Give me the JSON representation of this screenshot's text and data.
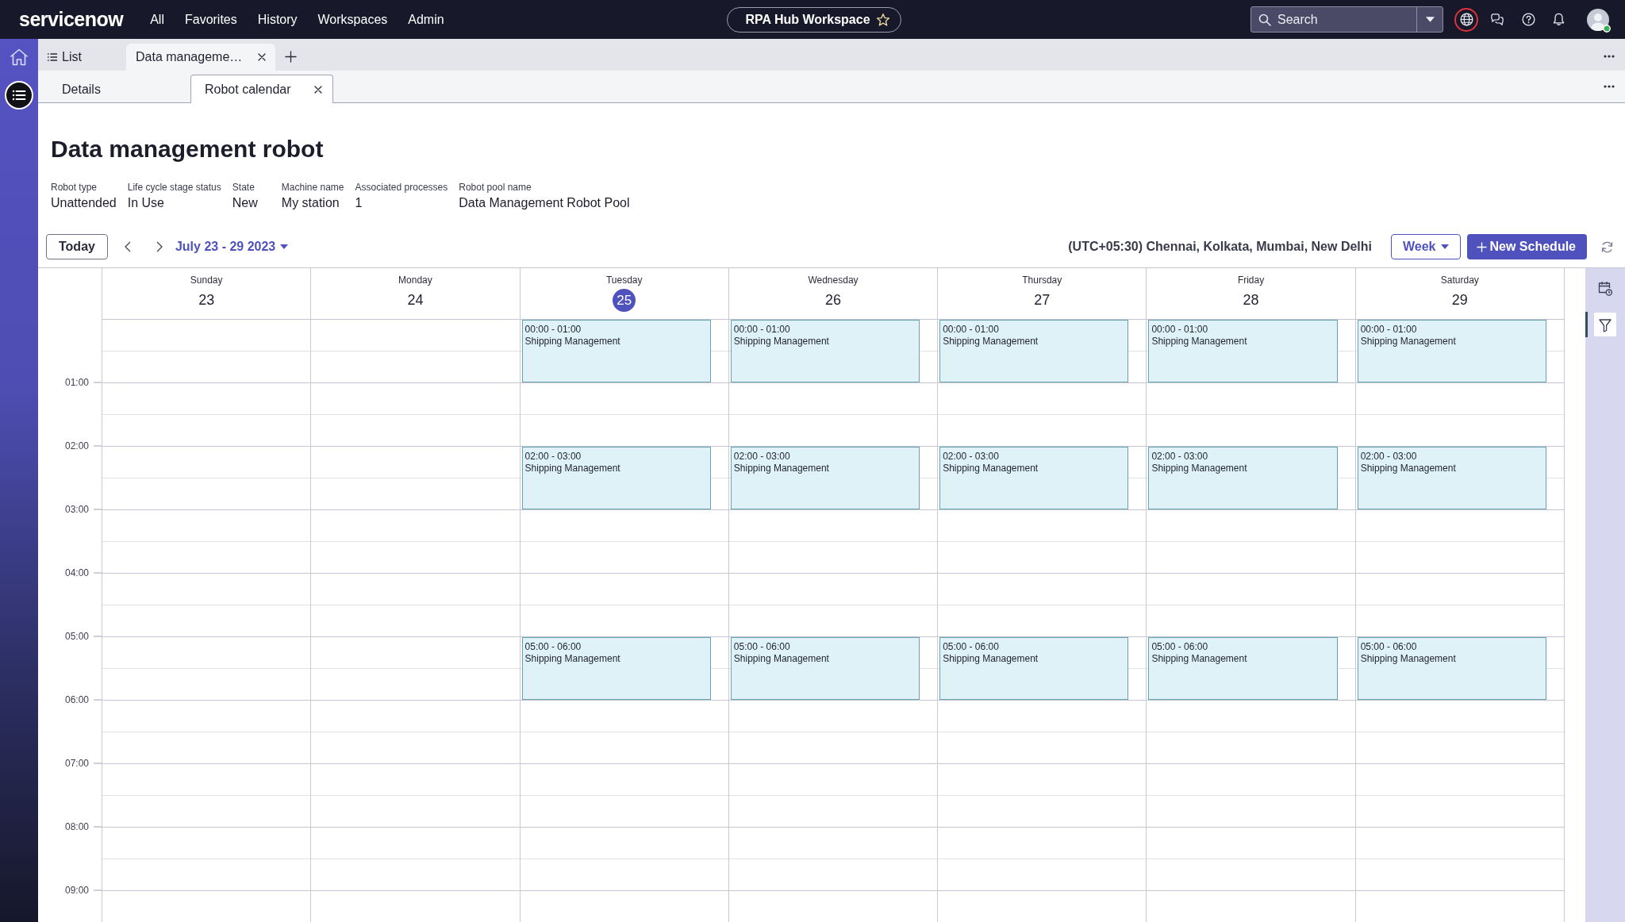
{
  "top_bar": {
    "logo": "servicenow",
    "nav": [
      {
        "label": "All"
      },
      {
        "label": "Favorites"
      },
      {
        "label": "History"
      },
      {
        "label": "Workspaces"
      },
      {
        "label": "Admin"
      }
    ],
    "workspace": {
      "label": "RPA Hub Workspace",
      "starred": false
    },
    "search": {
      "placeholder": "Search"
    },
    "language_button": {
      "highlighted": true
    },
    "avatar": {
      "online": true
    }
  },
  "left_rail": {
    "items": [
      {
        "kind": "home",
        "selected": false
      },
      {
        "kind": "menu",
        "selected": true
      }
    ]
  },
  "tabs": [
    {
      "kind": "list",
      "label": "List",
      "selected": false,
      "closable": false
    },
    {
      "kind": "record",
      "label": "Data manageme…",
      "selected": true,
      "closable": true
    }
  ],
  "subtabs": [
    {
      "label": "Details",
      "selected": false,
      "closable": false
    },
    {
      "label": "Robot calendar",
      "selected": true,
      "closable": true
    }
  ],
  "record": {
    "title": "Data management robot",
    "fields": [
      {
        "label": "Robot type",
        "value": "Unattended"
      },
      {
        "label": "Life cycle stage status",
        "value": "In Use"
      },
      {
        "label": "State",
        "value": "New"
      },
      {
        "label": "Machine name",
        "value": "My station"
      },
      {
        "label": "Associated processes",
        "value": "1"
      },
      {
        "label": "Robot pool name",
        "value": "Data Management Robot Pool"
      }
    ]
  },
  "toolbar": {
    "today": "Today",
    "range": "July 23 - 29 2023",
    "timezone": "(UTC+05:30) Chennai, Kolkata, Mumbai, New Delhi",
    "view": "Week",
    "new_button": "New Schedule"
  },
  "calendar": {
    "time_labels": [
      "01:00",
      "02:00",
      "03:00",
      "04:00",
      "05:00",
      "06:00",
      "07:00",
      "08:00",
      "09:00"
    ],
    "days": [
      {
        "name": "Sunday",
        "date": "23",
        "today": false,
        "slots": [
          {
            "kind": "free"
          },
          {
            "kind": "free"
          },
          {
            "kind": "free"
          },
          {
            "kind": "free"
          },
          {
            "kind": "free"
          },
          {
            "kind": "free"
          },
          {
            "kind": "free"
          },
          {
            "kind": "free"
          },
          {
            "kind": "free"
          },
          {
            "kind": "free"
          }
        ]
      },
      {
        "name": "Monday",
        "date": "24",
        "today": false,
        "slots": [
          {
            "kind": "free"
          },
          {
            "kind": "free"
          },
          {
            "kind": "free"
          },
          {
            "kind": "free"
          },
          {
            "kind": "free"
          },
          {
            "kind": "free"
          },
          {
            "kind": "free"
          },
          {
            "kind": "free"
          },
          {
            "kind": "free"
          },
          {
            "kind": "free"
          }
        ]
      },
      {
        "name": "Tuesday",
        "date": "25",
        "today": true,
        "slots": [
          {
            "kind": "event",
            "time": "00:00 - 01:00",
            "title": "Shipping Management"
          },
          {
            "kind": "free"
          },
          {
            "kind": "event",
            "time": "02:00 - 03:00",
            "title": "Shipping Management"
          },
          {
            "kind": "free"
          },
          {
            "kind": "free"
          },
          {
            "kind": "event",
            "time": "05:00 - 06:00",
            "title": "Shipping Management"
          },
          {
            "kind": "free"
          },
          {
            "kind": "free"
          },
          {
            "kind": "free"
          },
          {
            "kind": "free"
          }
        ]
      },
      {
        "name": "Wednesday",
        "date": "26",
        "today": false,
        "slots": [
          {
            "kind": "event",
            "time": "00:00 - 01:00",
            "title": "Shipping Management"
          },
          {
            "kind": "free"
          },
          {
            "kind": "event",
            "time": "02:00 - 03:00",
            "title": "Shipping Management"
          },
          {
            "kind": "free"
          },
          {
            "kind": "free"
          },
          {
            "kind": "event",
            "time": "05:00 - 06:00",
            "title": "Shipping Management"
          },
          {
            "kind": "free"
          },
          {
            "kind": "free"
          },
          {
            "kind": "free"
          },
          {
            "kind": "free"
          }
        ]
      },
      {
        "name": "Thursday",
        "date": "27",
        "today": false,
        "slots": [
          {
            "kind": "event",
            "time": "00:00 - 01:00",
            "title": "Shipping Management"
          },
          {
            "kind": "free"
          },
          {
            "kind": "event",
            "time": "02:00 - 03:00",
            "title": "Shipping Management"
          },
          {
            "kind": "free"
          },
          {
            "kind": "free"
          },
          {
            "kind": "event",
            "time": "05:00 - 06:00",
            "title": "Shipping Management"
          },
          {
            "kind": "free"
          },
          {
            "kind": "free"
          },
          {
            "kind": "free"
          },
          {
            "kind": "free"
          }
        ]
      },
      {
        "name": "Friday",
        "date": "28",
        "today": false,
        "slots": [
          {
            "kind": "event",
            "time": "00:00 - 01:00",
            "title": "Shipping Management"
          },
          {
            "kind": "free"
          },
          {
            "kind": "event",
            "time": "02:00 - 03:00",
            "title": "Shipping Management"
          },
          {
            "kind": "free"
          },
          {
            "kind": "free"
          },
          {
            "kind": "event",
            "time": "05:00 - 06:00",
            "title": "Shipping Management"
          },
          {
            "kind": "free"
          },
          {
            "kind": "free"
          },
          {
            "kind": "free"
          },
          {
            "kind": "free"
          }
        ]
      },
      {
        "name": "Saturday",
        "date": "29",
        "today": false,
        "slots": [
          {
            "kind": "event",
            "time": "00:00 - 01:00",
            "title": "Shipping Management"
          },
          {
            "kind": "free"
          },
          {
            "kind": "event",
            "time": "02:00 - 03:00",
            "title": "Shipping Management"
          },
          {
            "kind": "free"
          },
          {
            "kind": "free"
          },
          {
            "kind": "event",
            "time": "05:00 - 06:00",
            "title": "Shipping Management"
          },
          {
            "kind": "free"
          },
          {
            "kind": "free"
          },
          {
            "kind": "free"
          },
          {
            "kind": "free"
          }
        ]
      }
    ]
  },
  "side_tools": [
    {
      "kind": "schedule",
      "selected": false
    },
    {
      "kind": "filter",
      "selected": true
    }
  ]
}
